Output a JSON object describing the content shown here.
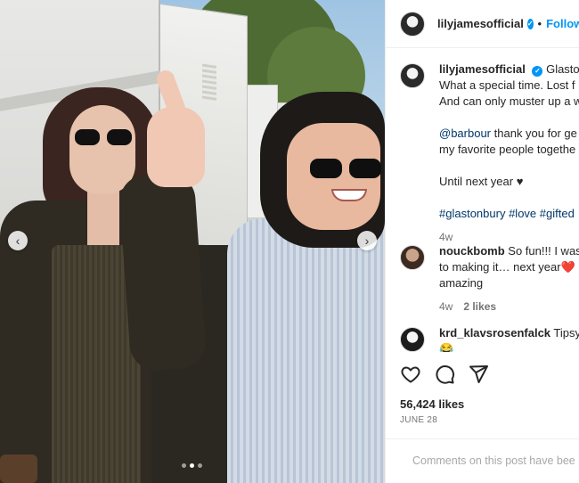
{
  "post": {
    "carousel": {
      "prev_icon": "chevron-left-icon",
      "next_icon": "chevron-right-icon",
      "slide_count": 3,
      "active_slide": 2
    }
  },
  "header": {
    "username": "lilyjamesofficial",
    "separator": "•",
    "follow_label": "Follow"
  },
  "caption": {
    "username": "lilyjamesofficial",
    "lines": [
      "Glaston",
      "What a special time. Lost f",
      "And can only muster up a w"
    ],
    "mention": "@barbour",
    "mention_text": "thank you for ge",
    "line_after_mention": "my favorite people togethe",
    "until": "Until next year",
    "heart": "♥",
    "hashtags": [
      "#glastonbury",
      "#love",
      "#gifted"
    ],
    "age": "4w"
  },
  "comments": [
    {
      "username": "nouckbomb",
      "text_line1": "So fun!!! I was",
      "text_line2": "to making it… next year",
      "emoji": "❤️",
      "text_line3": "amazing",
      "age": "4w",
      "likes": "2 likes"
    },
    {
      "username": "krd_klavsrosenfalck",
      "text_line1": "Tipsy",
      "emoji": "😂"
    }
  ],
  "actions": {
    "like_icon": "heart-outline-icon",
    "comment_icon": "comment-bubble-icon",
    "share_icon": "paper-plane-icon"
  },
  "likes_count": "56,424 likes",
  "date": "JUNE 28",
  "comments_disabled": "Comments on this post have bee",
  "colors": {
    "link": "#0095f6",
    "hashtag": "#00376b",
    "muted": "#737373"
  }
}
